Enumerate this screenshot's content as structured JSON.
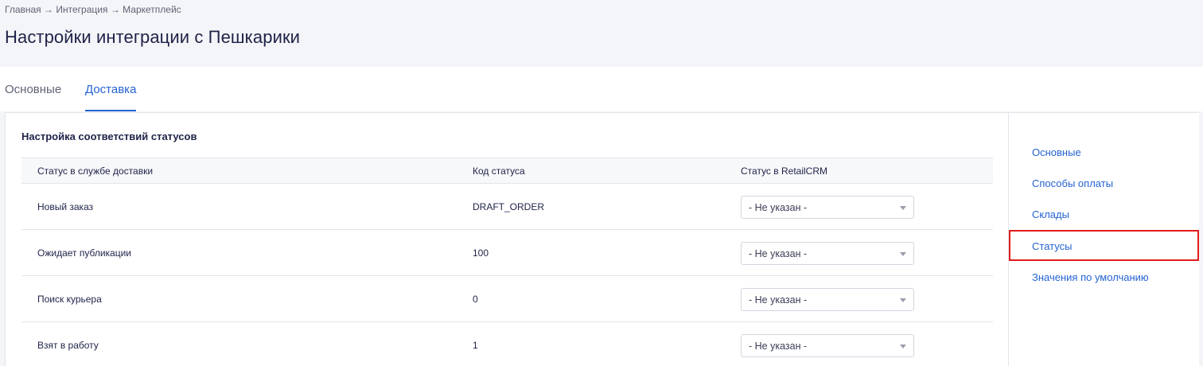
{
  "breadcrumb": {
    "items": [
      "Главная",
      "Интеграция",
      "Маркетплейс"
    ],
    "separator": "→"
  },
  "page_title": "Настройки интеграции с Пешкарики",
  "tabs": [
    {
      "label": "Основные",
      "active": false
    },
    {
      "label": "Доставка",
      "active": true
    }
  ],
  "section": {
    "title": "Настройка соответствий статусов",
    "columns": [
      "Статус в службе доставки",
      "Код статуса",
      "Статус в RetailCRM"
    ],
    "rows": [
      {
        "delivery_status": "Новый заказ",
        "code": "DRAFT_ORDER",
        "crm_status": "- Не указан -"
      },
      {
        "delivery_status": "Ожидает публикации",
        "code": "100",
        "crm_status": "- Не указан -"
      },
      {
        "delivery_status": "Поиск курьера",
        "code": "0",
        "crm_status": "- Не указан -"
      },
      {
        "delivery_status": "Взят в работу",
        "code": "1",
        "crm_status": "- Не указан -"
      }
    ]
  },
  "side_nav": {
    "items": [
      "Основные",
      "Способы оплаты",
      "Склады",
      "Статусы",
      "Значения по умолчанию"
    ],
    "highlighted": "Статусы"
  },
  "colors": {
    "accent": "#2563d4",
    "highlight_border": "#e31b1b",
    "header_bg": "#f4f5f8",
    "text": "#1e2248"
  },
  "icons": {
    "select_caret": "caret-down-icon"
  }
}
